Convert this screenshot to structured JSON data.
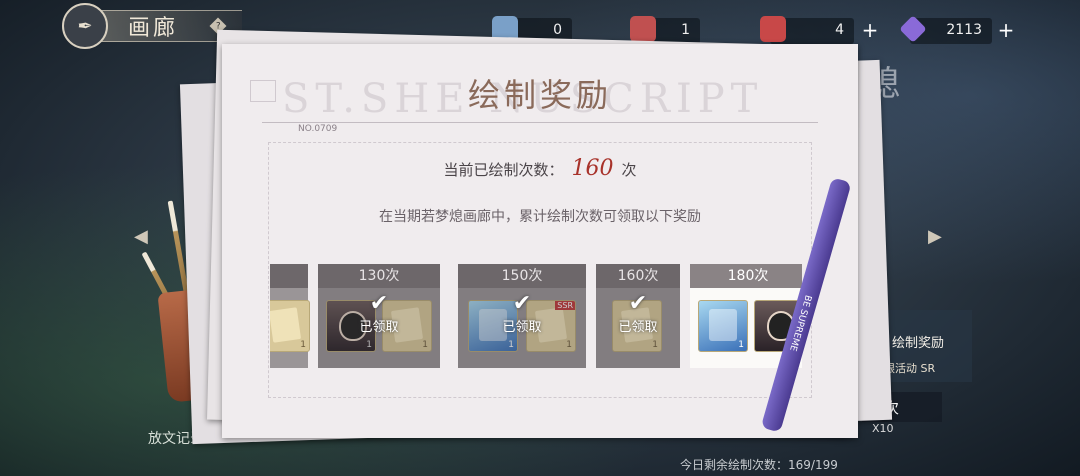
{
  "header": {
    "title": "画廊",
    "help": "?",
    "resources": [
      {
        "name": "ticket-a",
        "value": "0",
        "color": "#7aa0c8"
      },
      {
        "name": "ticket-b",
        "value": "1",
        "color": "#c05050"
      },
      {
        "name": "ticket-c",
        "value": "4",
        "color": "#c84848"
      },
      {
        "name": "diamond",
        "value": "2113",
        "color": "#8a6ad8"
      }
    ],
    "plus": "+"
  },
  "panel": {
    "title": "绘制奖励",
    "watermark": "ST.SHE   NUSCRIPT",
    "serial": "NO.0709",
    "count_prefix": "当前已绘制次数：",
    "count_value": "160",
    "count_suffix": "次",
    "description": "在当期若梦熄画廊中，累计绘制次数可领取以下奖励"
  },
  "rewards": [
    {
      "label": "",
      "claimed": false,
      "partial": true
    },
    {
      "label": "130次",
      "claimed": true,
      "claimed_text": "已领取"
    },
    {
      "label": "150次",
      "claimed": true,
      "claimed_text": "已领取",
      "tag": "SSR"
    },
    {
      "label": "160次",
      "claimed": true,
      "claimed_text": "已领取"
    },
    {
      "label": "180次",
      "claimed": false
    }
  ],
  "side": {
    "left_note": "放文记录",
    "right_deco": "熄",
    "right_card_title": "绘制奖励",
    "right_card_sub": "限活动 SR",
    "right_button": "次",
    "right_button_x10": "X10",
    "bottom_note": "今日剩余绘制次数：169/199",
    "pen_label": "BE SUPREME"
  }
}
